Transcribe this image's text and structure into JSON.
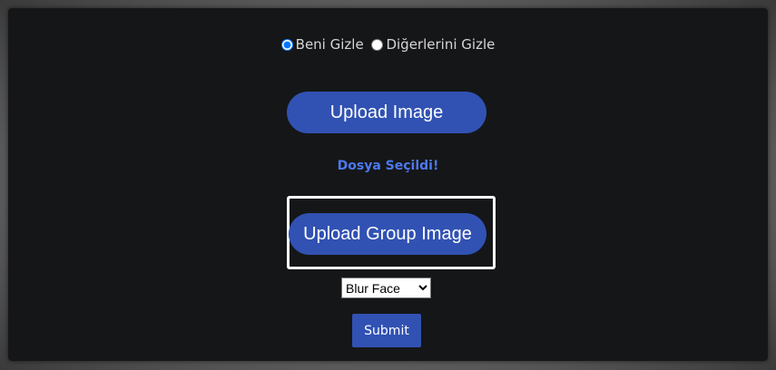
{
  "radios": {
    "option1_label": "Beni Gizle",
    "option2_label": "Diğerlerini Gizle",
    "selected": "Beni Gizle"
  },
  "buttons": {
    "upload_image": "Upload Image",
    "upload_group_image": "Upload Group Image",
    "submit": "Submit"
  },
  "status_text": "Dosya Seçildi!",
  "effect_select": {
    "selected": "Blur Face"
  },
  "colors": {
    "background": "#151618",
    "accent": "#3152b3",
    "status": "#4c79f2"
  }
}
